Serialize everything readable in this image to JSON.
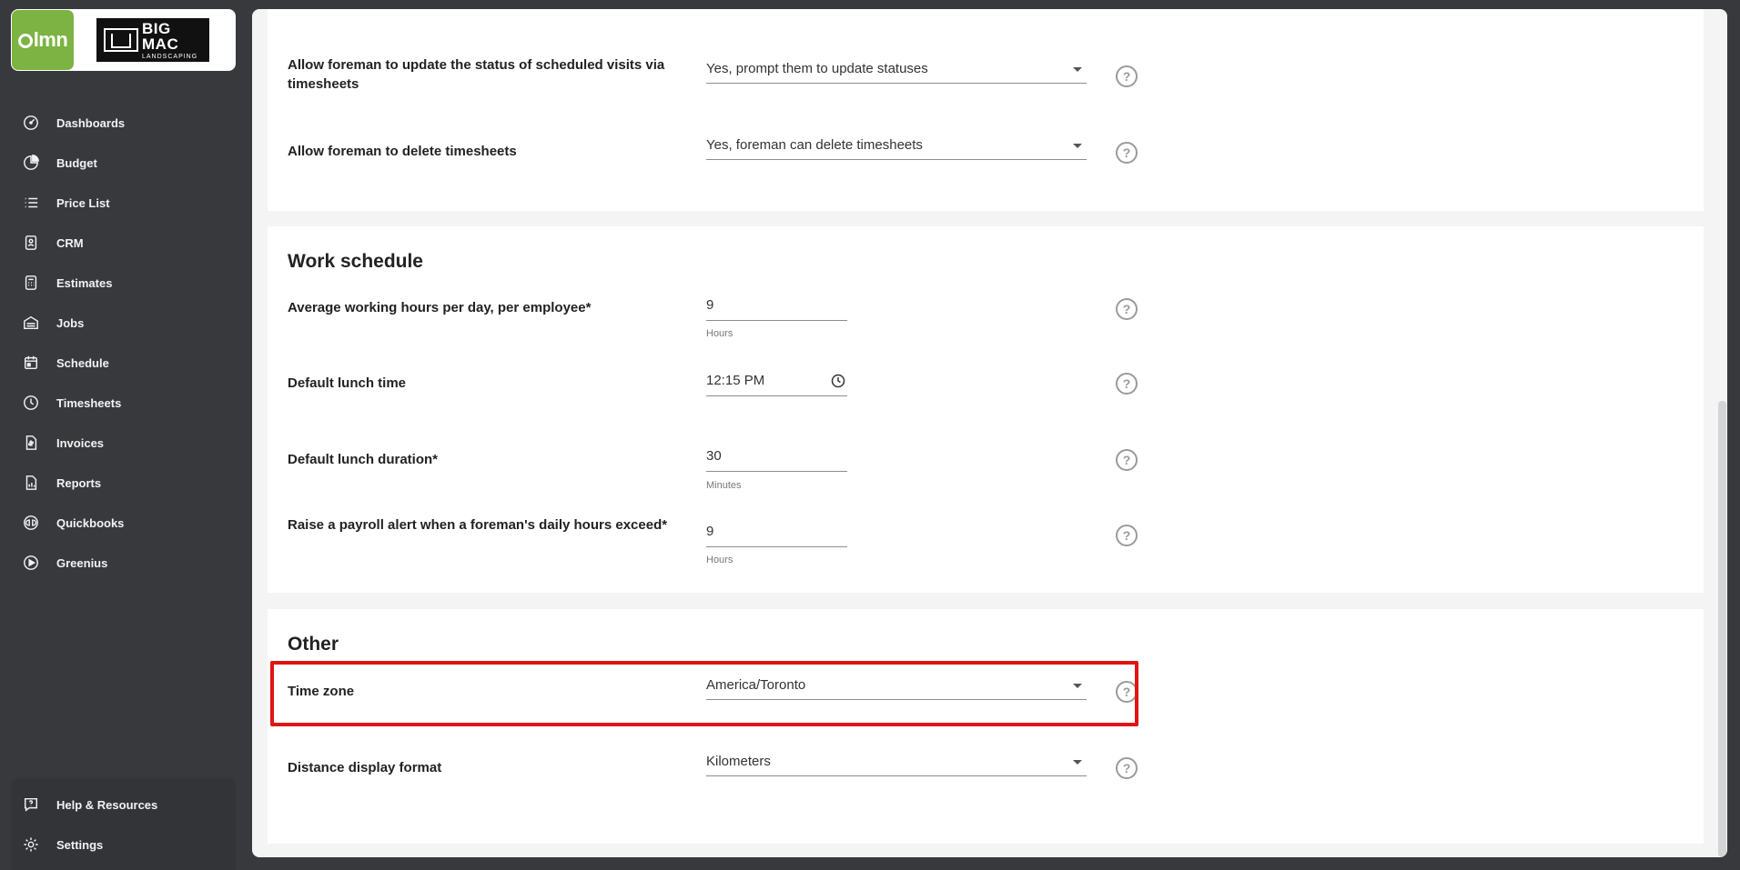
{
  "sidebar": {
    "logo": {
      "lmn_text": "lmn",
      "brand_line1": "BIG",
      "brand_line2": "MAC",
      "brand_line3": "LANDSCAPING"
    },
    "items": [
      {
        "label": "Dashboards",
        "icon": "dashboard-icon"
      },
      {
        "label": "Budget",
        "icon": "pie-chart-icon"
      },
      {
        "label": "Price List",
        "icon": "list-icon"
      },
      {
        "label": "CRM",
        "icon": "contact-icon"
      },
      {
        "label": "Estimates",
        "icon": "calculator-icon"
      },
      {
        "label": "Jobs",
        "icon": "garage-icon"
      },
      {
        "label": "Schedule",
        "icon": "calendar-icon"
      },
      {
        "label": "Timesheets",
        "icon": "clock-icon"
      },
      {
        "label": "Invoices",
        "icon": "invoice-icon"
      },
      {
        "label": "Reports",
        "icon": "report-icon"
      },
      {
        "label": "Quickbooks",
        "icon": "quickbooks-icon"
      },
      {
        "label": "Greenius",
        "icon": "play-icon"
      }
    ],
    "bottom": [
      {
        "label": "Help & Resources",
        "icon": "help-icon"
      },
      {
        "label": "Settings",
        "icon": "gear-icon"
      }
    ]
  },
  "timesheets_section": {
    "rows": [
      {
        "label": "Allow foreman to update the status of scheduled visits via timesheets",
        "value": "Yes, prompt them to update statuses"
      },
      {
        "label": "Allow foreman to delete timesheets",
        "value": "Yes, foreman can delete timesheets"
      }
    ]
  },
  "work_schedule": {
    "title": "Work schedule",
    "avg_hours": {
      "label": "Average working hours per day, per employee*",
      "value": "9",
      "unit": "Hours"
    },
    "lunch_time": {
      "label": "Default lunch time",
      "value": "12:15 PM"
    },
    "lunch_duration": {
      "label": "Default lunch duration*",
      "value": "30",
      "unit": "Minutes"
    },
    "payroll_alert": {
      "label": "Raise a payroll alert when a foreman's daily hours exceed*",
      "value": "9",
      "unit": "Hours"
    }
  },
  "other": {
    "title": "Other",
    "time_zone": {
      "label": "Time zone",
      "value": "America/Toronto"
    },
    "distance_format": {
      "label": "Distance display format",
      "value": "Kilometers"
    }
  },
  "help_glyph": "?",
  "colors": {
    "accent_green": "#7cb342",
    "highlight_red": "#e01414",
    "sidebar_bg": "#38393d"
  }
}
